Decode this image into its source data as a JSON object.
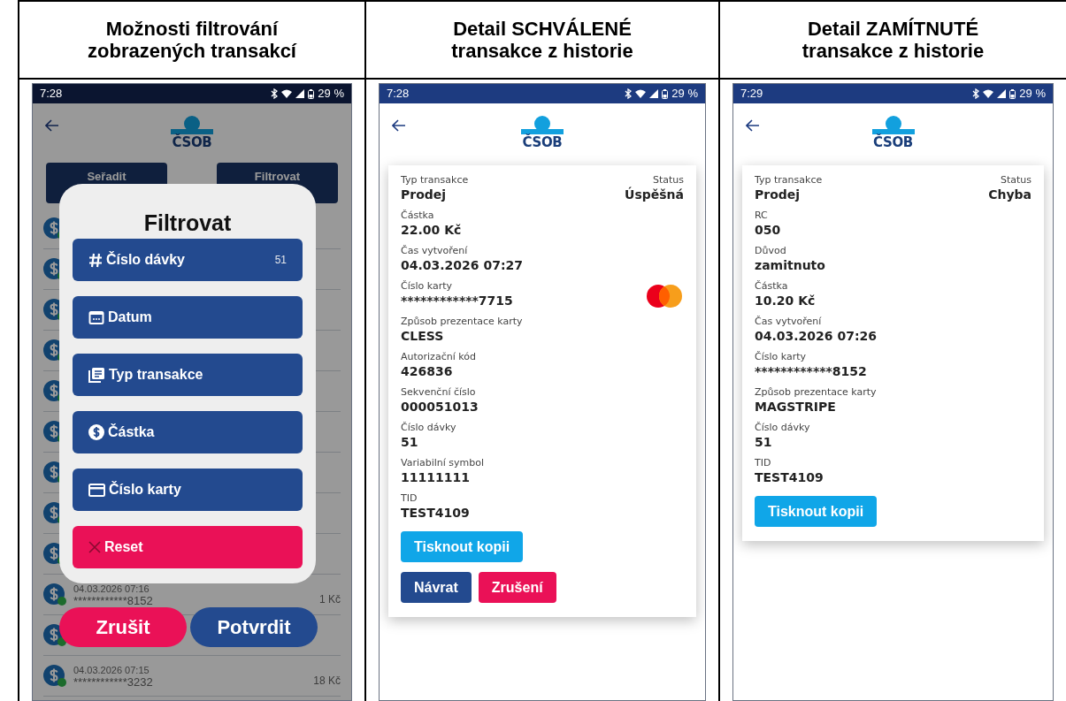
{
  "columns": [
    {
      "heading": "Možnosti filtrování zobrazených transakcí",
      "kind": "filter",
      "screen": {
        "status_bar": {
          "time": "7:28",
          "battery": "29 %"
        },
        "logo_text": "ČSOB",
        "sort_button": {
          "label": "Seřadit"
        },
        "filter_button": {
          "label": "Filtrovat"
        },
        "list_rows": [
          {
            "date": "04.03.2026 07:16",
            "card": "************8152",
            "amount": "1 Kč"
          },
          {
            "date": "04.03.2026 07:15",
            "card": "************3232",
            "amount": "18 Kč"
          }
        ],
        "dialog": {
          "title": "Filtrovat",
          "options": [
            {
              "kind": "number",
              "label": "Číslo dávky",
              "value": "51"
            },
            {
              "kind": "date",
              "label": "Datum"
            },
            {
              "kind": "type",
              "label": "Typ transakce"
            },
            {
              "kind": "amount",
              "label": "Částka"
            },
            {
              "kind": "card",
              "label": "Číslo karty"
            },
            {
              "kind": "reset",
              "label": "Reset"
            }
          ],
          "buttons": [
            {
              "kind": "cancel",
              "label": "Zrušit"
            },
            {
              "kind": "confirm",
              "label": "Potvrdit"
            }
          ]
        }
      }
    },
    {
      "heading": "Detail SCHVÁLENÉ transakce z historie",
      "kind": "detail",
      "screen": {
        "status_bar": {
          "time": "7:28",
          "battery": "29 %"
        },
        "logo_text": "ČSOB",
        "status": {
          "label": "Status",
          "value": "Úspěšná"
        },
        "fields": [
          {
            "label": "Typ transakce",
            "value": "Prodej",
            "card_logo": false
          },
          {
            "label": "Částka",
            "value": "22.00 Kč",
            "card_logo": false
          },
          {
            "label": "Čas vytvoření",
            "value": "04.03.2026 07:27",
            "card_logo": false
          },
          {
            "label": "Číslo karty",
            "value": "************7715",
            "card_logo": true
          },
          {
            "label": "Způsob prezentace karty",
            "value": "CLESS",
            "card_logo": false
          },
          {
            "label": "Autorizační kód",
            "value": "426836",
            "card_logo": false
          },
          {
            "label": "Sekvenční číslo",
            "value": "000051013",
            "card_logo": false
          },
          {
            "label": "Číslo dávky",
            "value": "51",
            "card_logo": false
          },
          {
            "label": "Variabilní symbol",
            "value": "11111111",
            "card_logo": false
          },
          {
            "label": "TID",
            "value": "TEST4109",
            "card_logo": false
          }
        ],
        "buttons": [
          {
            "kind": "print",
            "label": "Tisknout kopii"
          },
          {
            "kind": "back",
            "label": "Návrat"
          },
          {
            "kind": "cancel",
            "label": "Zrušení"
          }
        ]
      }
    },
    {
      "heading": "Detail ZAMÍTNUTÉ transakce z historie",
      "kind": "detail",
      "screen": {
        "status_bar": {
          "time": "7:29",
          "battery": "29 %"
        },
        "logo_text": "ČSOB",
        "status": {
          "label": "Status",
          "value": "Chyba"
        },
        "fields": [
          {
            "label": "Typ transakce",
            "value": "Prodej",
            "card_logo": false
          },
          {
            "label": "RC",
            "value": "050",
            "card_logo": false
          },
          {
            "label": "Důvod",
            "value": "zamitnuto",
            "card_logo": false
          },
          {
            "label": "Částka",
            "value": "10.20 Kč",
            "card_logo": false
          },
          {
            "label": "Čas vytvoření",
            "value": "04.03.2026 07:26",
            "card_logo": false
          },
          {
            "label": "Číslo karty",
            "value": "************8152",
            "card_logo": false
          },
          {
            "label": "Způsob prezentace karty",
            "value": "MAGSTRIPE",
            "card_logo": false
          },
          {
            "label": "Číslo dávky",
            "value": "51",
            "card_logo": false
          },
          {
            "label": "TID",
            "value": "TEST4109",
            "card_logo": false
          }
        ],
        "buttons": [
          {
            "kind": "print",
            "label": "Tisknout kopii"
          }
        ]
      }
    }
  ]
}
